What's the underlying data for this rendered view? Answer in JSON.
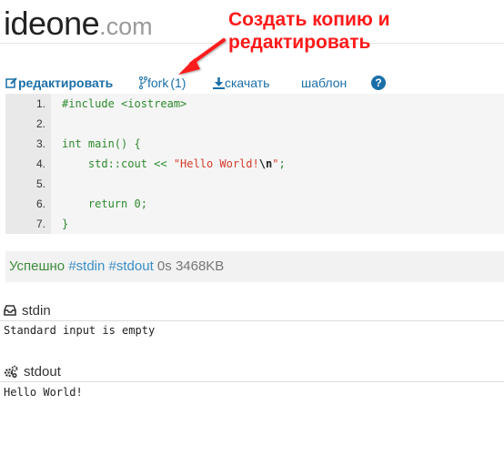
{
  "header": {
    "logo_main": "ideone",
    "logo_domain": ".com"
  },
  "annotation": {
    "line1": "Создать копию и",
    "line2": "редактировать",
    "color": "#ff1a1a"
  },
  "toolbar": {
    "edit_label": "редактировать",
    "fork_label": "fork",
    "fork_count": "(1)",
    "download_label": "скачать",
    "template_label": "шаблон",
    "help_label": "?"
  },
  "code": {
    "line_numbers": [
      "1.",
      "2.",
      "3.",
      "4.",
      "5.",
      "6.",
      "7."
    ],
    "lines": [
      [
        {
          "t": "#include <iostream>",
          "c": ""
        }
      ],
      [],
      [
        {
          "t": "int main() {",
          "c": ""
        }
      ],
      [
        {
          "t": "    std::cout << ",
          "c": ""
        },
        {
          "t": "\"Hello World!",
          "c": "tk-str"
        },
        {
          "t": "\\n",
          "c": "tk-esc"
        },
        {
          "t": "\"",
          "c": "tk-str"
        },
        {
          "t": ";",
          "c": ""
        }
      ],
      [],
      [
        {
          "t": "    return 0;",
          "c": ""
        }
      ],
      [
        {
          "t": "}",
          "c": ""
        }
      ]
    ]
  },
  "result": {
    "status": "Успешно",
    "stdin_link": "#stdin",
    "stdout_link": "#stdout",
    "time": "0s",
    "memory": "3468KB"
  },
  "stdin": {
    "title": "stdin",
    "content": "Standard input is empty"
  },
  "stdout": {
    "title": "stdout",
    "content": "Hello World!"
  },
  "colors": {
    "link": "#1b6fa8",
    "success": "#3c8c3c",
    "annotation": "#ff1a1a"
  }
}
